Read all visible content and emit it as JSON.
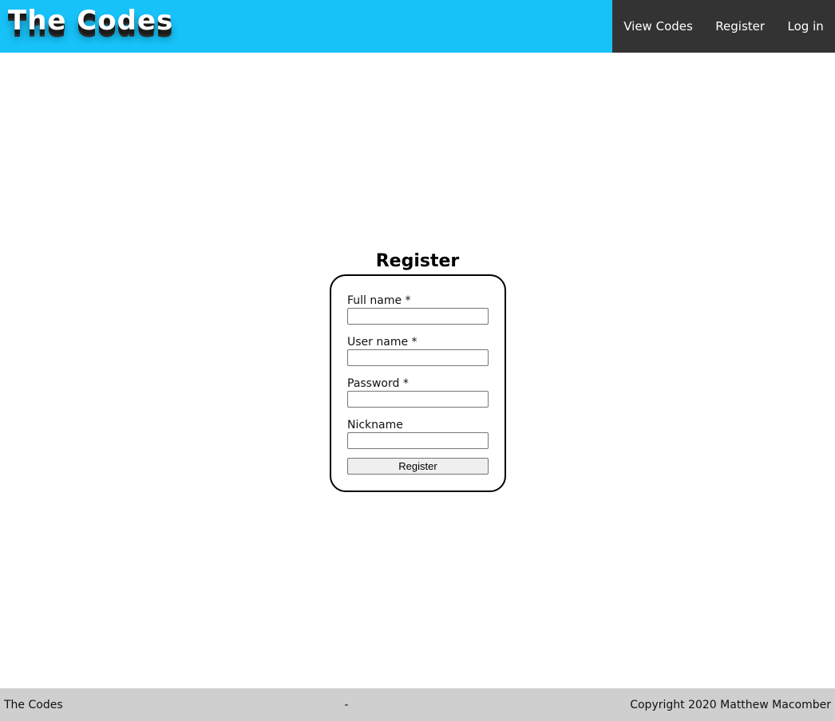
{
  "header": {
    "logo_text": "The Codes",
    "bg_color": "#17c2f8",
    "nav": {
      "bg_color": "#333333",
      "items": [
        {
          "label": "View Codes"
        },
        {
          "label": "Register"
        },
        {
          "label": "Log in"
        }
      ]
    }
  },
  "form": {
    "title": "Register",
    "fields": [
      {
        "label": "Full name *",
        "value": "",
        "type": "text"
      },
      {
        "label": "User name *",
        "value": "",
        "type": "text"
      },
      {
        "label": "Password *",
        "value": "",
        "type": "password"
      },
      {
        "label": "Nickname",
        "value": "",
        "type": "text"
      }
    ],
    "submit_label": "Register"
  },
  "footer": {
    "left": "The Codes",
    "center": "-",
    "right": "Copyright 2020 Matthew Macomber",
    "bg_color": "#cfcfcf"
  }
}
